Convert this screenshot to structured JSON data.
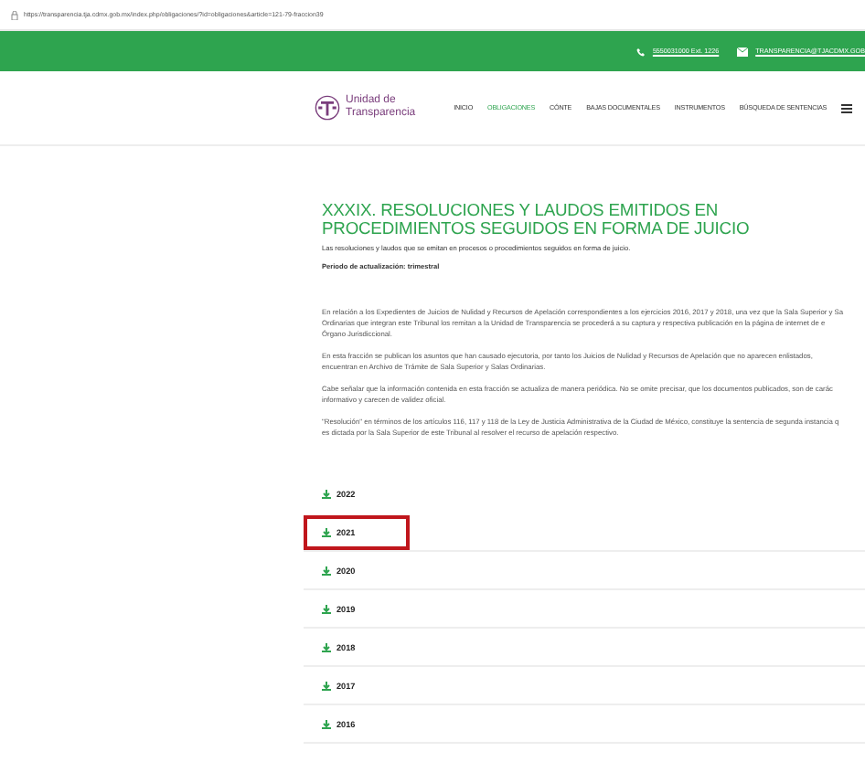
{
  "address_bar": {
    "url": "https://transparencia.tja.cdmx.gob.mx/index.php/obligaciones/?id=obligaciones&article=121-79-fraccion39"
  },
  "top_bar": {
    "phone": "5550031000 Ext. 1226",
    "email": "TRANSPARENCIA@TJACDMX.GOB"
  },
  "header": {
    "logo_line_1": "Unidad de",
    "logo_line_2": "Transparencia",
    "nav": [
      {
        "label": "INICIO",
        "selected": false
      },
      {
        "label": "OBLIGACIONES",
        "selected": true
      },
      {
        "label": "CÓNTE",
        "selected": false
      },
      {
        "label": "BAJAS DOCUMENTALES",
        "selected": false
      },
      {
        "label": "INSTRUMENTOS",
        "selected": false
      },
      {
        "label": "BÚSQUEDA DE SENTENCIAS",
        "selected": false
      }
    ]
  },
  "title": "XXXIX. RESOLUCIONES Y LAUDOS EMITIDOS EN PROCEDIMIENTOS SEGUIDOS EN FORMA DE JUICIO",
  "intro": "Las resoluciones y laudos que se emitan en procesos o procedimientos seguidos en forma de juicio.",
  "period": "Periodo de actualización: trimestral",
  "paragraphs": [
    {
      "lines": [
        "En relación a los Expedientes de Juicios de Nulidad y Recursos de Apelación correspondientes a los ejercicios 2016, 2017 y 2018, una vez que la Sala Superior y Sa",
        "Ordinarias que integran este Tribunal los remitan a la Unidad de Transparencia se procederá a su captura y respectiva publicación en la página de internet de e",
        "Órgano Jurisdiccional."
      ]
    },
    {
      "lines": [
        "En esta fracción se publican los asuntos que han causado ejecutoria, por tanto los Juicios de Nulidad y Recursos de Apelación que no aparecen enlistados,",
        "encuentran en Archivo de Trámite de Sala Superior y Salas Ordinarias."
      ]
    },
    {
      "lines": [
        "Cabe señalar que la información contenida en esta fracción se actualiza de manera periódica. No se omite precisar, que los documentos publicados, son de carác",
        "informativo y carecen de validez oficial."
      ]
    },
    {
      "lines": [
        "\"Resolución\" en términos de los artículos 116, 117 y 118 de la Ley de Justicia Administrativa de la Ciudad de México, constituye la sentencia de segunda instancia q",
        "es dictada por la Sala Superior de este Tribunal al resolver el recurso de apelación respectivo."
      ]
    }
  ],
  "years": [
    {
      "label": "2022",
      "highlighted": false
    },
    {
      "label": "2021",
      "highlighted": true
    },
    {
      "label": "2020",
      "highlighted": false
    },
    {
      "label": "2019",
      "highlighted": false
    },
    {
      "label": "2018",
      "highlighted": false
    },
    {
      "label": "2017",
      "highlighted": false
    },
    {
      "label": "2016",
      "highlighted": false
    }
  ]
}
